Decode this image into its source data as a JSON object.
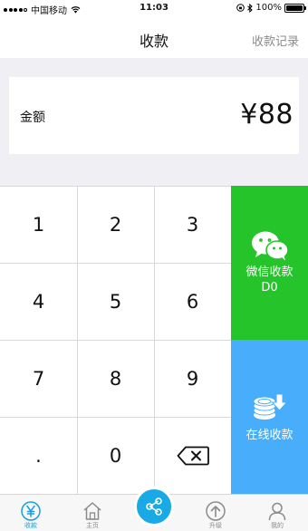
{
  "status_bar": {
    "carrier": "中国移动",
    "time": "11:03",
    "battery": "100%",
    "signal_bars": 4
  },
  "nav": {
    "title": "收款",
    "right_link": "收款记录"
  },
  "amount": {
    "label": "金额",
    "value": "¥88"
  },
  "keypad": {
    "keys": [
      "1",
      "2",
      "3",
      "4",
      "5",
      "6",
      "7",
      "8",
      "9",
      ".",
      "0"
    ],
    "backspace_icon": "backspace-icon"
  },
  "wechat_pay": {
    "line1": "微信收款",
    "line2": "D0",
    "color": "#24c42a",
    "icon": "wechat-icon"
  },
  "online_pay": {
    "label": "在线收款",
    "color": "#48aefb",
    "icon": "coins-download-icon"
  },
  "tab_bar": {
    "tabs": [
      {
        "label": "收款",
        "icon": "yen-icon",
        "active": true
      },
      {
        "label": "主页",
        "icon": "home-icon",
        "active": false
      },
      {
        "label": "升级",
        "icon": "upgrade-icon",
        "active": false
      },
      {
        "label": "我的",
        "icon": "user-icon",
        "active": false
      }
    ],
    "share_icon": "share-icon",
    "accent": "#19a9e5"
  }
}
